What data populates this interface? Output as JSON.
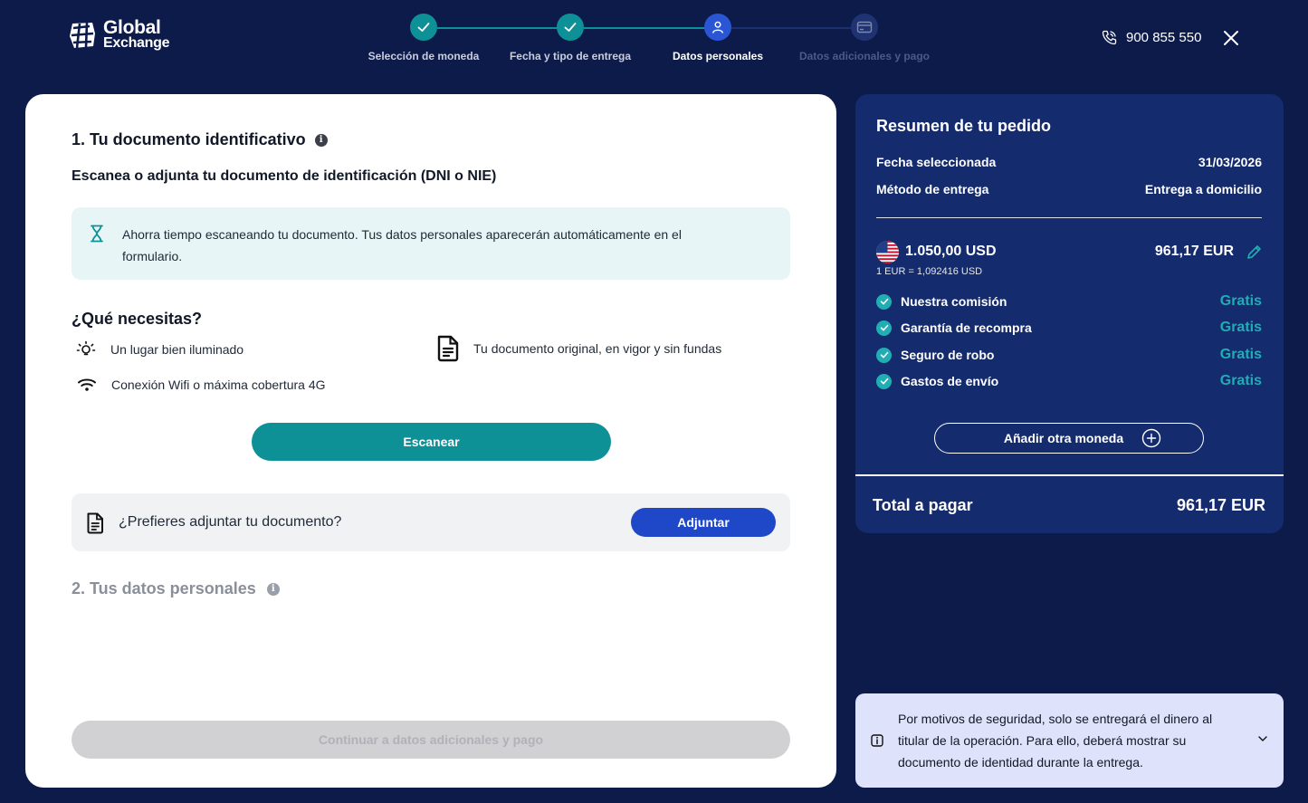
{
  "brand": {
    "line1": "Global",
    "line2": "Exchange"
  },
  "stepper": {
    "steps": [
      {
        "label": "Selección de moneda",
        "state": "done"
      },
      {
        "label": "Fecha y tipo de entrega",
        "state": "done"
      },
      {
        "label": "Datos personales",
        "state": "current"
      },
      {
        "label": "Datos adicionales y pago",
        "state": "pending"
      }
    ]
  },
  "header": {
    "phone": "900 855 550"
  },
  "colors": {
    "navy": "#0d1b4b",
    "teal": "#0e9196",
    "blue": "#1f48c9",
    "summary": "#142b6e"
  },
  "document": {
    "section_title": "1. Tu documento identificativo",
    "subtitle": "Escanea o adjunta tu documento de identificación (DNI o NIE)",
    "notice": "Ahorra tiempo escaneando tu documento. Tus datos personales aparecerán automáticamente en el formulario.",
    "needs_title": "¿Qué necesitas?",
    "needs": [
      "Un lugar bien iluminado",
      "Tu documento original, en vigor y sin fundas",
      "Conexión Wifi o máxima cobertura 4G"
    ],
    "scan_button": "Escanear",
    "attach_question": "¿Prefieres adjuntar tu documento?",
    "attach_button": "Adjuntar"
  },
  "personal": {
    "section_title": "2. Tus datos personales"
  },
  "continue_button": "Continuar a datos adicionales y pago",
  "summary": {
    "title": "Resumen de tu pedido",
    "date_label": "Fecha seleccionada",
    "date_value": "31/03/2026",
    "method_label": "Método de entrega",
    "method_value": "Entrega a domicilio",
    "currency_amount": "1.050,00 USD",
    "currency_eur": "961,17 EUR",
    "rate": "1 EUR = 1,092416 USD",
    "features": [
      {
        "label": "Nuestra comisión",
        "value": "Gratis"
      },
      {
        "label": "Garantía de recompra",
        "value": "Gratis"
      },
      {
        "label": "Seguro de robo",
        "value": "Gratis"
      },
      {
        "label": "Gastos de envío",
        "value": "Gratis"
      }
    ],
    "add_currency": "Añadir otra moneda",
    "total_label": "Total a pagar",
    "total_value": "961,17 EUR"
  },
  "security_notice": "Por motivos de seguridad, solo se entregará el dinero al titular de la operación. Para ello, deberá mostrar su documento de identidad durante la entrega."
}
